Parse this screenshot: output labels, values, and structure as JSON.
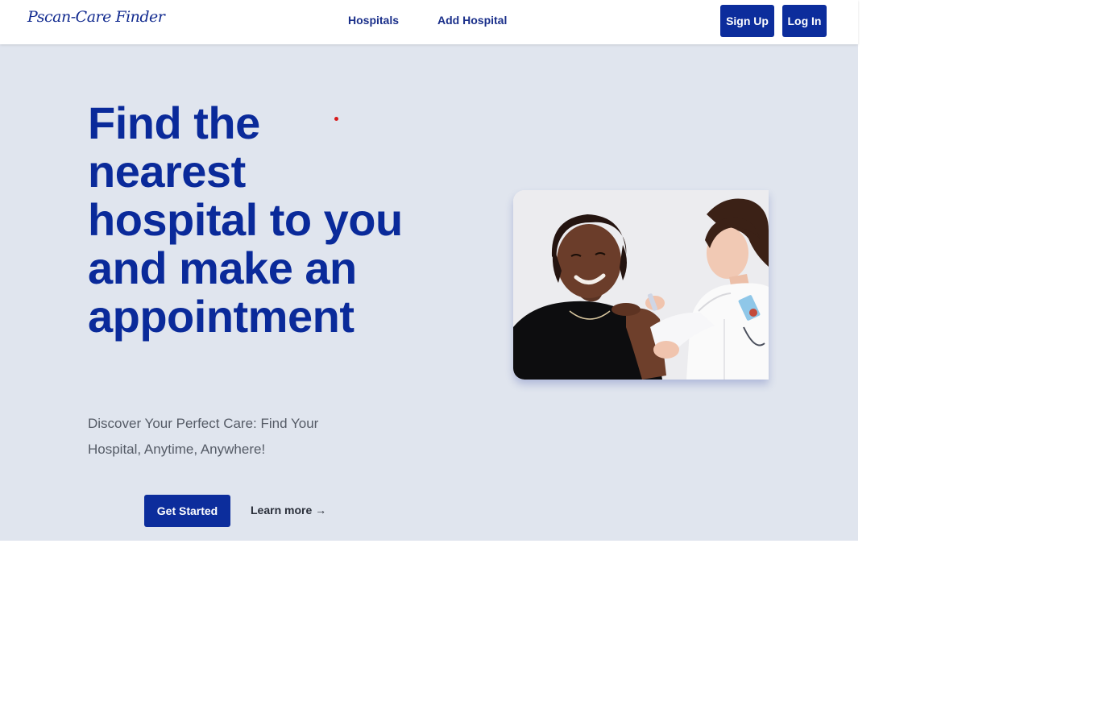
{
  "brand": {
    "logo_text": "Pscan-Care Finder"
  },
  "nav": {
    "links": [
      {
        "label": "Hospitals"
      },
      {
        "label": "Add Hospital"
      }
    ],
    "signup_label": "Sign Up",
    "login_label": "Log In"
  },
  "hero": {
    "headline": "Find the nearest hospital to you and make an appointment",
    "subtext": "Discover Your Perfect Care: Find Your Hospital, Anytime, Anywhere!",
    "cta_primary": "Get Started",
    "cta_secondary": "Learn more →",
    "image": "doctor-vaccinating-patient-photo"
  },
  "colors": {
    "primary": "#0c2d9c",
    "heading": "#0a2a9a",
    "hero_background": "#e0e5ee",
    "accent_dot": "#d81b1b",
    "body_text": "#555b66"
  }
}
